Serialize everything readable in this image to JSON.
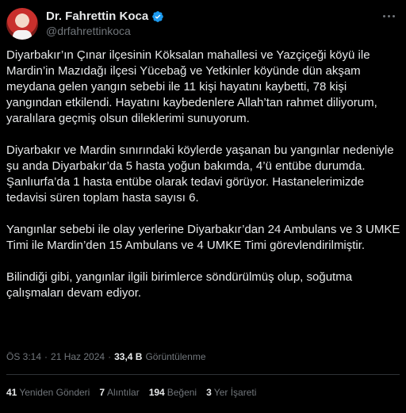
{
  "author": {
    "name": "Dr. Fahrettin Koca",
    "handle": "@drfahrettinkoca",
    "avatar_icon": "profile-photo",
    "verified_icon": "verified-badge-icon",
    "verified_color": "#1d9bf0"
  },
  "body": {
    "paragraphs": [
      "Diyarbakır’ın Çınar ilçesinin Köksalan mahallesi ve Yazçiçeği köyü ile Mardin’in Mazıdağı ilçesi Yücebağ ve Yetkinler köyünde dün akşam meydana gelen yangın sebebi ile 11 kişi hayatını kaybetti, 78 kişi yangından etkilendi. Hayatını kaybedenlere Allah’tan rahmet diliyorum, yaralılara geçmiş olsun dileklerimi sunuyorum.",
      "Diyarbakır ve Mardin sınırındaki köylerde yaşanan bu yangınlar nedeniyle şu anda Diyarbakır’da 5 hasta yoğun bakımda, 4’ü entübe durumda. Şanlıurfa’da 1 hasta entübe olarak tedavi görüyor. Hastanelerimizde tedavisi süren toplam hasta sayısı 6.",
      "Yangınlar sebebi ile olay yerlerine Diyarbakır’dan 24 Ambulans ve 3 UMKE Timi ile Mardin’den 15 Ambulans ve 4 UMKE Timi görevlendirilmiştir.",
      "Bilindiği gibi, yangınlar ilgili birimlerce söndürülmüş olup, soğutma çalışmaları devam ediyor."
    ]
  },
  "meta": {
    "time": "ÖS 3:14",
    "separator": "·",
    "date": "21 Haz 2024",
    "views_count": "33,4 B",
    "views_label": "Görüntülenme"
  },
  "stats": {
    "retweets": {
      "count": "41",
      "label": "Yeniden Gönderi"
    },
    "quotes": {
      "count": "7",
      "label": "Alıntılar"
    },
    "likes": {
      "count": "194",
      "label": "Beğeni"
    },
    "bookmarks": {
      "count": "3",
      "label": "Yer İşareti"
    }
  },
  "colors": {
    "background": "#000000",
    "text": "#e7e9ea",
    "muted": "#71767b",
    "divider": "#2f3336"
  }
}
